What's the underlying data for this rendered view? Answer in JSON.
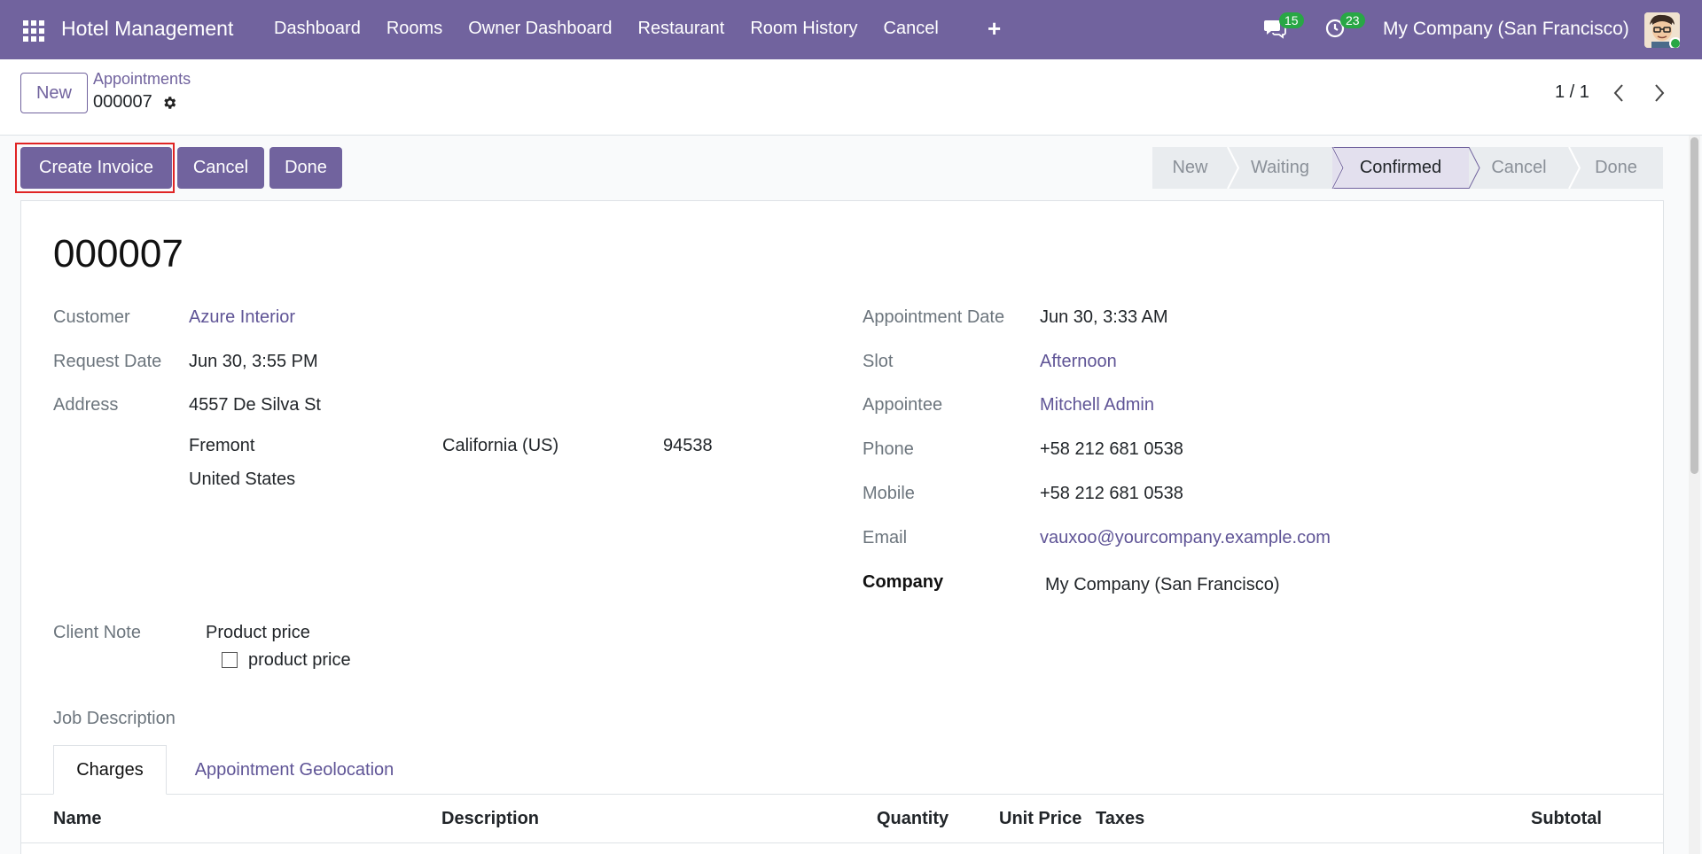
{
  "navbar": {
    "brand": "Hotel Management",
    "menu": [
      "Dashboard",
      "Rooms",
      "Owner Dashboard",
      "Restaurant",
      "Room History",
      "Cancel"
    ],
    "plus_symbol": "+",
    "messages_badge": "15",
    "activities_badge": "23",
    "company": "My Company (San Francisco)",
    "icons": [
      "apps-grid-icon",
      "chat-icon",
      "clock-icon"
    ]
  },
  "control_panel": {
    "new_label": "New",
    "breadcrumb": "Appointments",
    "record_name": "000007",
    "pager": "1 / 1"
  },
  "actions": {
    "create_invoice": "Create Invoice",
    "cancel": "Cancel",
    "done": "Done"
  },
  "statusbar": {
    "stages": [
      "New",
      "Waiting",
      "Confirmed",
      "Cancel",
      "Done"
    ],
    "active": "Confirmed"
  },
  "form": {
    "title": "000007",
    "customer_label": "Customer",
    "customer": "Azure Interior",
    "request_date_label": "Request Date",
    "request_date": "Jun 30, 3:55 PM",
    "address_label": "Address",
    "street": "4557 De Silva St",
    "city": "Fremont",
    "state": "California (US)",
    "zip": "94538",
    "country": "United States",
    "appointment_date_label": "Appointment Date",
    "appointment_date": "Jun 30, 3:33 AM",
    "slot_label": "Slot",
    "slot": "Afternoon",
    "appointee_label": "Appointee",
    "appointee": "Mitchell Admin",
    "phone_label": "Phone",
    "phone": "+58 212 681 0538",
    "mobile_label": "Mobile",
    "mobile": "+58 212 681 0538",
    "email_label": "Email",
    "email": "vauxoo@yourcompany.example.com",
    "company_label": "Company",
    "company": "My Company (San Francisco)",
    "client_note_label": "Client Note",
    "client_note_title": "Product price",
    "client_note_item": "product price",
    "job_description_label": "Job Description"
  },
  "tabs": [
    "Charges",
    "Appointment Geolocation"
  ],
  "table": {
    "columns": [
      "Name",
      "Description",
      "Quantity",
      "Unit Price",
      "Taxes",
      "Subtotal"
    ]
  },
  "colors": {
    "brand": "#71639e",
    "link": "#5f5496",
    "badge": "#28a745",
    "highlight": "#e02424"
  }
}
